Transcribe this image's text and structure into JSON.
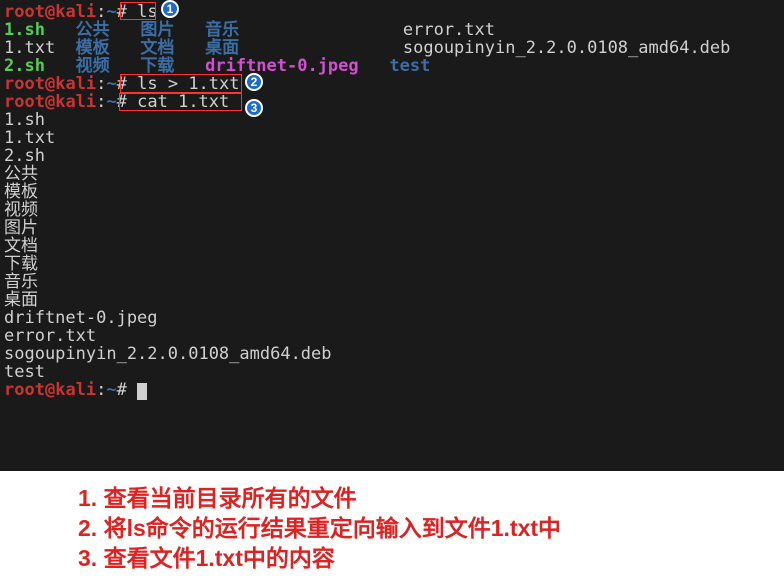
{
  "prompt": {
    "user": "root",
    "at": "@",
    "host": "kali",
    "colon": ":",
    "path": "~",
    "hash": "# "
  },
  "cmd1": "ls",
  "cmd2": "ls > 1.txt",
  "cmd3": "cat 1.txt",
  "ls_output": {
    "row1": {
      "c1": "1.sh",
      "c2": "公共",
      "c3": "图片",
      "c4": "音乐",
      "c5": "error.txt"
    },
    "row2": {
      "c1": "1.txt",
      "c2": "模板",
      "c3": "文档",
      "c4": "桌面",
      "c5": "sogoupinyin_2.2.0.0108_amd64.deb"
    },
    "row3": {
      "c1": "2.sh",
      "c2": "视频",
      "c3": "下载",
      "c4": "driftnet-0.jpeg",
      "c5": "test"
    }
  },
  "cat_output": [
    "1.sh",
    "1.txt",
    "2.sh",
    "公共",
    "模板",
    "视频",
    "图片",
    "文档",
    "下载",
    "音乐",
    "桌面",
    "driftnet-0.jpeg",
    "error.txt",
    "sogoupinyin_2.2.0.0108_amd64.deb",
    "test"
  ],
  "markers": {
    "m1": "1",
    "m2": "2",
    "m3": "3"
  },
  "annotations": {
    "a1": "1. 查看当前目录所有的文件",
    "a2": "2. 将ls命令的运行结果重定向输入到文件1.txt中",
    "a3": "3. 查看文件1.txt中的内容"
  }
}
